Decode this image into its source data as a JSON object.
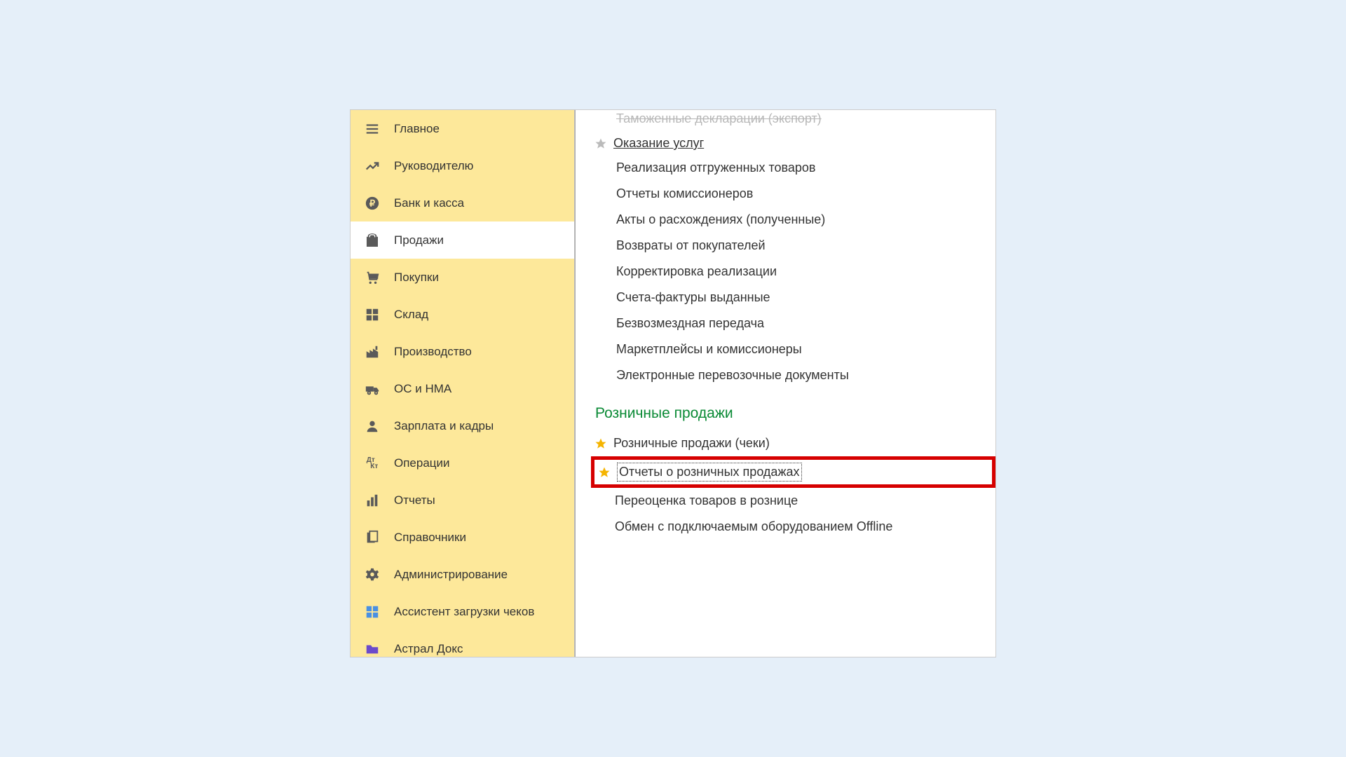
{
  "sidebar": {
    "items": [
      {
        "id": "main",
        "label": "Главное",
        "icon": "menu-icon",
        "active": false
      },
      {
        "id": "leader",
        "label": "Руководителю",
        "icon": "trending-icon",
        "active": false
      },
      {
        "id": "bank",
        "label": "Банк и касса",
        "icon": "ruble-icon",
        "active": false
      },
      {
        "id": "sales",
        "label": "Продажи",
        "icon": "bag-icon",
        "active": true
      },
      {
        "id": "purchases",
        "label": "Покупки",
        "icon": "cart-icon",
        "active": false
      },
      {
        "id": "warehouse",
        "label": "Склад",
        "icon": "grid-icon",
        "active": false
      },
      {
        "id": "production",
        "label": "Производство",
        "icon": "factory-icon",
        "active": false
      },
      {
        "id": "fixed-assets",
        "label": "ОС и НМА",
        "icon": "truck-icon",
        "active": false
      },
      {
        "id": "payroll",
        "label": "Зарплата и кадры",
        "icon": "person-icon",
        "active": false
      },
      {
        "id": "operations",
        "label": "Операции",
        "icon": "dtkr-icon",
        "active": false
      },
      {
        "id": "reports",
        "label": "Отчеты",
        "icon": "bars-icon",
        "active": false
      },
      {
        "id": "catalogs",
        "label": "Справочники",
        "icon": "books-icon",
        "active": false
      },
      {
        "id": "admin",
        "label": "Администрирование",
        "icon": "gear-icon",
        "active": false
      },
      {
        "id": "receipt-assistant",
        "label": "Ассистент загрузки чеков",
        "icon": "tiles-icon",
        "active": false
      },
      {
        "id": "astral",
        "label": "Астрал Докс",
        "icon": "folder-icon",
        "active": false
      }
    ]
  },
  "main": {
    "cutoff_item": "Таможенные декларации (экспорт)",
    "services_link": "Оказание услуг",
    "sales_subitems": [
      "Реализация отгруженных товаров",
      "Отчеты комиссионеров",
      "Акты о расхождениях (полученные)",
      "Возвраты от покупателей",
      "Корректировка реализации",
      "Счета-фактуры выданные",
      "Безвозмездная передача",
      "Маркетплейсы и комиссионеры",
      "Электронные перевозочные документы"
    ],
    "retail_heading": "Розничные продажи",
    "retail_items": [
      {
        "label": "Розничные продажи (чеки)",
        "starred": true,
        "highlighted": false
      },
      {
        "label": "Отчеты о розничных продажах",
        "starred": true,
        "highlighted": true
      },
      {
        "label": "Переоценка товаров в рознице",
        "starred": false,
        "highlighted": false
      },
      {
        "label": "Обмен с подключаемым оборудованием Offline",
        "starred": false,
        "highlighted": false
      }
    ]
  }
}
